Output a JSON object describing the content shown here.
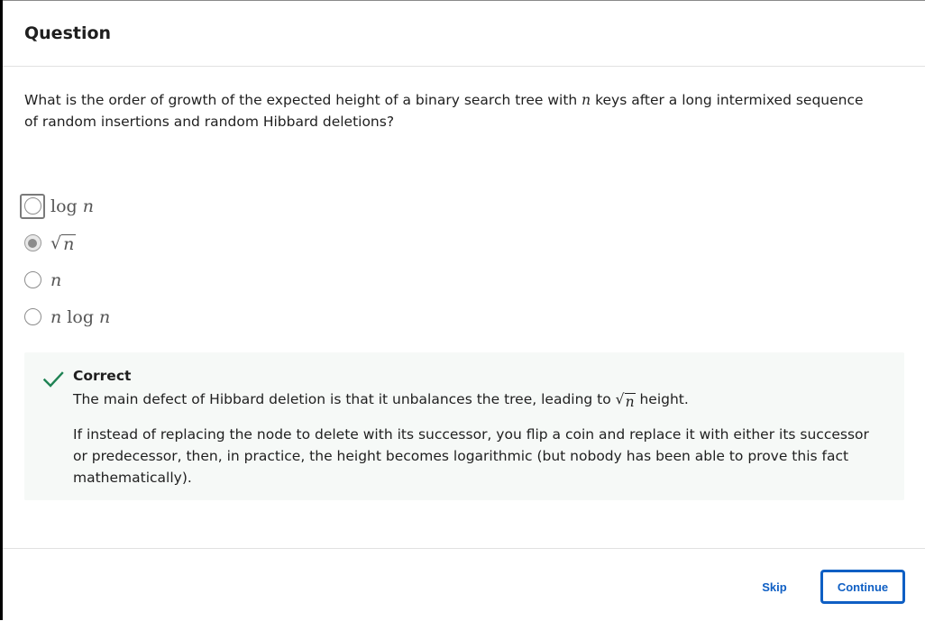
{
  "header": {
    "title": "Question"
  },
  "question": {
    "text_before": "What is the order of growth of the expected height of a binary search tree with ",
    "variable": "n",
    "text_after": " keys after a long intermixed sequence of random insertions and random Hibbard deletions?"
  },
  "options": [
    {
      "fn": "log",
      "var": "n",
      "selected": false,
      "focused": true
    },
    {
      "sqrt_var": "n",
      "selected": true,
      "focused": false
    },
    {
      "var": "n",
      "selected": false,
      "focused": false
    },
    {
      "var": "n",
      "fn": "log",
      "var2": "n",
      "selected": false,
      "focused": false
    }
  ],
  "feedback": {
    "status": "Correct",
    "line1_before": "The main defect of Hibbard deletion is that it unbalances the tree, leading to ",
    "line1_var": "n",
    "line1_after": " height.",
    "line2": "If instead of replacing the node to delete with its successor, you flip a coin and replace it with either its successor or predecessor, then, in practice, the height becomes logarithmic (but nobody has been able to prove this fact mathematically)."
  },
  "footer": {
    "skip_label": "Skip",
    "continue_label": "Continue"
  },
  "colors": {
    "accent": "#0f5fc4",
    "success": "#1f8354",
    "feedback_bg": "#f6f9f7"
  },
  "icons": {
    "feedback_status": "checkmark-icon"
  }
}
